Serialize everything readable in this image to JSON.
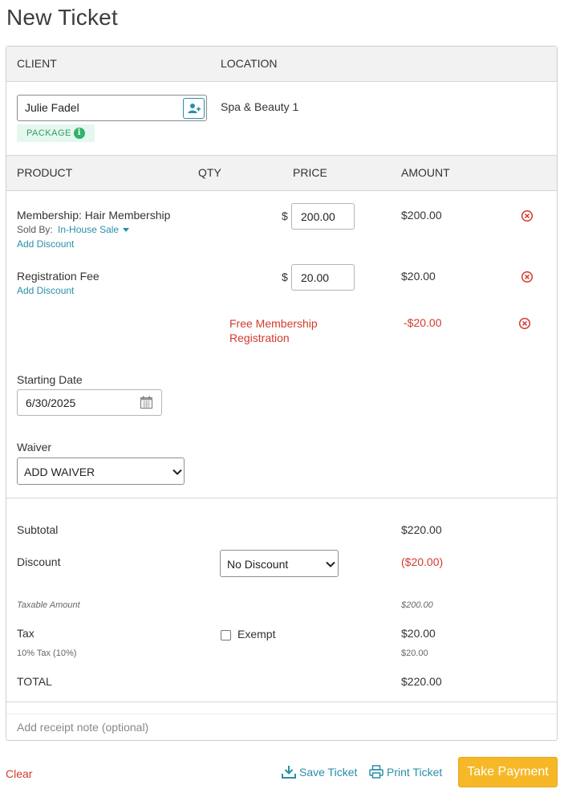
{
  "page": {
    "title": "New Ticket"
  },
  "client_section": {
    "client_header": "CLIENT",
    "location_header": "LOCATION",
    "client_name": "Julie Fadel",
    "location": "Spa & Beauty 1",
    "badge": "PACKAGE"
  },
  "products_header": {
    "product": "PRODUCT",
    "qty": "QTY",
    "price": "PRICE",
    "amount": "AMOUNT"
  },
  "line_items": [
    {
      "name": "Membership: Hair Membership",
      "sold_by_label": "Sold By:",
      "sold_by_value": "In-House Sale",
      "add_discount": "Add Discount",
      "currency": "$",
      "price": "200.00",
      "amount": "$200.00"
    },
    {
      "name": "Registration Fee",
      "add_discount": "Add Discount",
      "currency": "$",
      "price": "20.00",
      "amount": "$20.00"
    }
  ],
  "discount_line": {
    "name_line1": "Free Membership",
    "name_line2": "Registration",
    "amount": "-$20.00"
  },
  "starting_date": {
    "label": "Starting Date",
    "value": "6/30/2025"
  },
  "waiver": {
    "label": "Waiver",
    "selected": "ADD WAIVER"
  },
  "totals": {
    "subtotal_label": "Subtotal",
    "subtotal": "$220.00",
    "discount_label": "Discount",
    "discount_select": "No Discount",
    "discount_value": "($20.00)",
    "taxable_label": "Taxable Amount",
    "taxable_value": "$200.00",
    "tax_label": "Tax",
    "exempt_label": "Exempt",
    "tax_value": "$20.00",
    "tax_detail_label": "10% Tax (10%)",
    "tax_detail_value": "$20.00",
    "total_label": "TOTAL",
    "total_value": "$220.00"
  },
  "receipt_note": {
    "placeholder": "Add receipt note (optional)"
  },
  "actions": {
    "clear": "Clear",
    "save_ticket": "Save Ticket",
    "print_ticket": "Print Ticket",
    "take_payment": "Take Payment"
  },
  "colors": {
    "link": "#2a8fa8",
    "danger": "#d33a2c",
    "badge_bg": "#e5f7ee",
    "badge_text": "#2f9d63",
    "primary_button": "#f6b827"
  },
  "icons": {
    "add_client": "add-user-icon",
    "info": "info-icon",
    "remove": "remove-circle-icon",
    "calendar": "calendar-icon",
    "save": "download-icon",
    "print": "printer-icon"
  }
}
